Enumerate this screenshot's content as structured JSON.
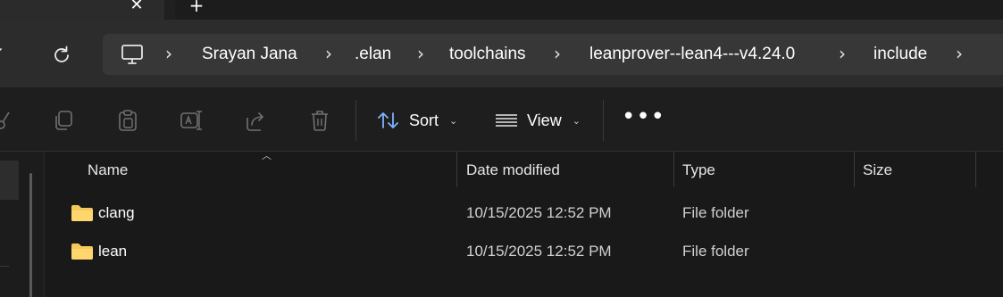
{
  "tabs": {
    "close_glyph": "✕",
    "new_tab_glyph": "+"
  },
  "address": {
    "breadcrumbs": [
      "Srayan Jana",
      ".elan",
      "toolchains",
      "leanprover--lean4---v4.24.0",
      "include"
    ],
    "separator": "›"
  },
  "command_bar": {
    "sort_label": "Sort",
    "view_label": "View",
    "more_label": "•••",
    "icons": [
      "cut-icon",
      "copy-icon",
      "paste-icon",
      "rename-icon",
      "share-icon",
      "delete-icon"
    ]
  },
  "file_list": {
    "columns": {
      "name": "Name",
      "date_modified": "Date modified",
      "type": "Type",
      "size": "Size"
    },
    "rows": [
      {
        "name": "clang",
        "date_modified": "10/15/2025 12:52 PM",
        "type": "File folder",
        "size": ""
      },
      {
        "name": "lean",
        "date_modified": "10/15/2025 12:52 PM",
        "type": "File folder",
        "size": ""
      }
    ]
  },
  "colors": {
    "background": "#191919",
    "address_row": "#2c2c2c",
    "address_bar": "#373737",
    "folder": "#f4c85a",
    "icon_accent": "#7fb1ff"
  }
}
